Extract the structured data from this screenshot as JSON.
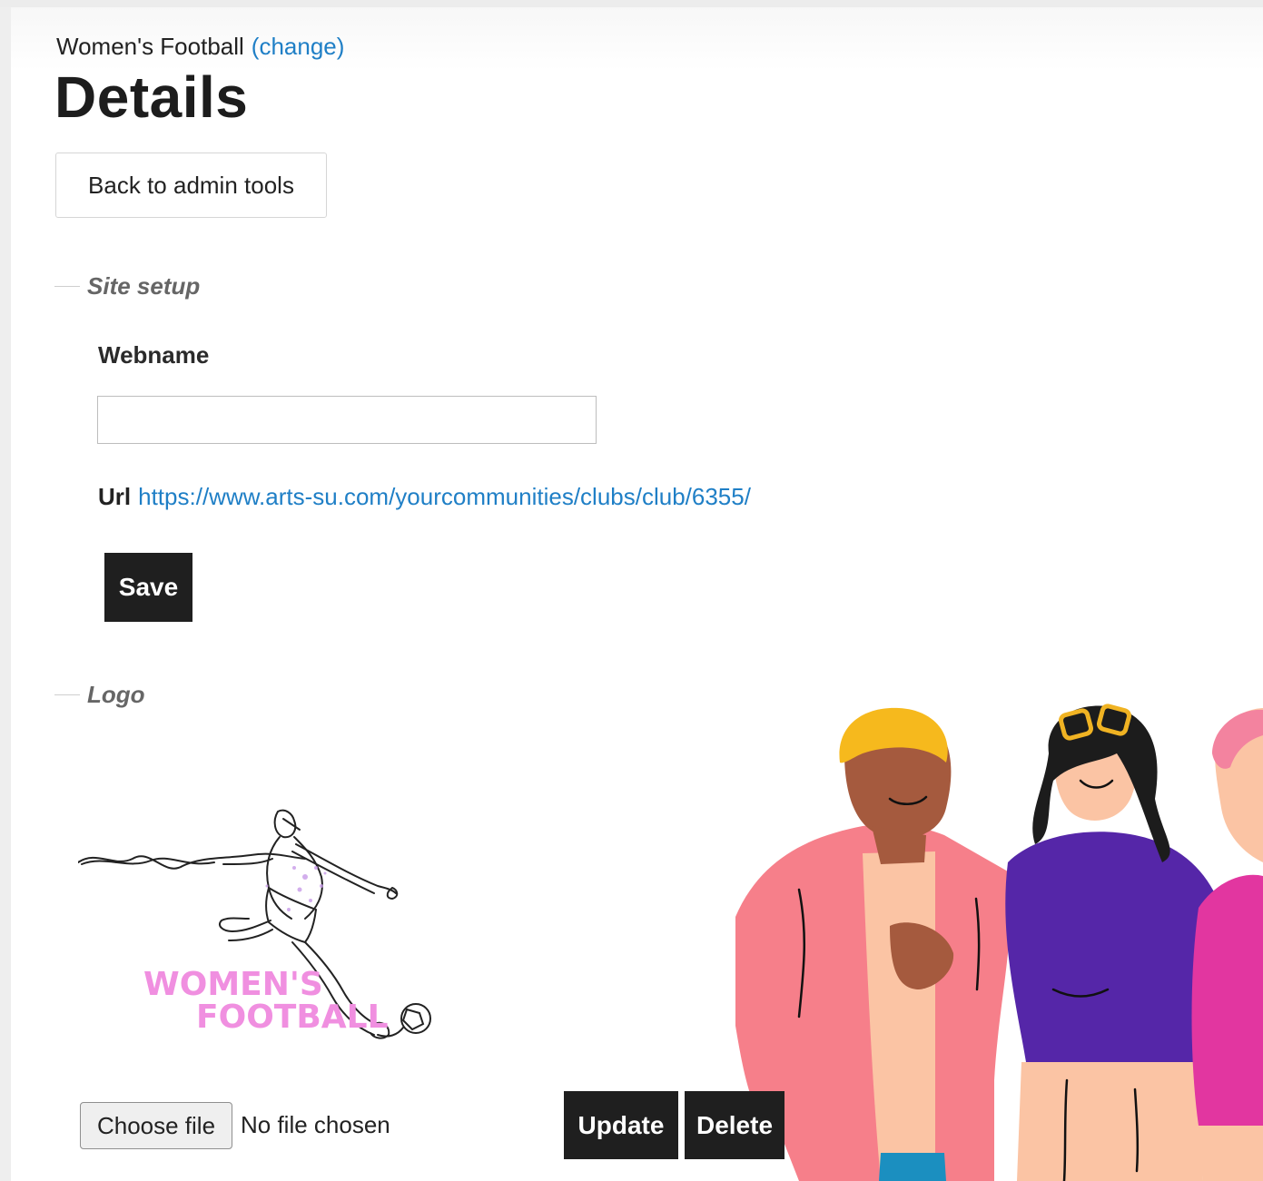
{
  "breadcrumb": {
    "club": "Women's Football",
    "change": "(change)"
  },
  "page_title": "Details",
  "back_button": "Back to admin tools",
  "site_setup": {
    "legend": "Site setup",
    "webname_label": "Webname",
    "webname_value": "",
    "url_label": "Url",
    "url_value": "https://www.arts-su.com/yourcommunities/clubs/club/6355/",
    "save_label": "Save"
  },
  "logo": {
    "legend": "Logo",
    "image_text_line1": "WOMEN'S",
    "image_text_line2": "FOOTBALL",
    "choose_file": "Choose file",
    "no_file": "No file chosen",
    "update_label": "Update",
    "delete_label": "Delete"
  },
  "colors": {
    "link": "#1f7fc6",
    "button_dark": "#1f1f1f",
    "logo_text": "#f08fe0"
  }
}
